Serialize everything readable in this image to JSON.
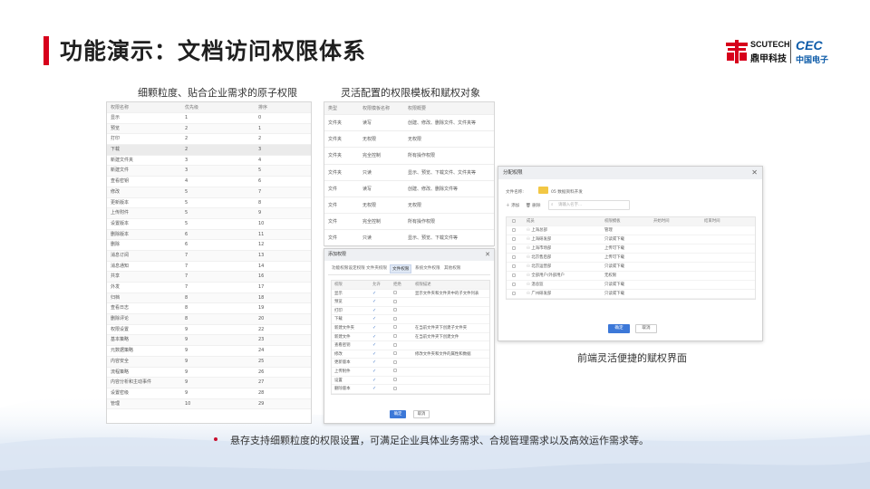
{
  "slide": {
    "title": "功能演示：文档访问权限体系",
    "logo": {
      "scutech_en": "SCUTECH",
      "scutech_cn": "鼎甲科技",
      "cec_en": "CEC",
      "cec_cn": "中国电子"
    },
    "caption_left": "细颗粒度、贴合企业需求的原子权限",
    "caption_mid": "灵活配置的权限模板和赋权对象",
    "caption_right": "前端灵活便捷的赋权界面",
    "bullet": "悬存支持细颗粒度的权限设置，可满足企业具体业务需求、合规管理需求以及高效运作需求等。"
  },
  "atom_table": {
    "headers": [
      "权限名称",
      "优先级",
      "排序"
    ],
    "rows": [
      [
        "显示",
        "1",
        "0"
      ],
      [
        "预览",
        "2",
        "1"
      ],
      [
        "打印",
        "2",
        "2"
      ],
      [
        "下载",
        "2",
        "3"
      ],
      [
        "新建文件夹",
        "3",
        "4"
      ],
      [
        "新建文件",
        "3",
        "5"
      ],
      [
        "查看密钥",
        "4",
        "6"
      ],
      [
        "修改",
        "5",
        "7"
      ],
      [
        "更新版本",
        "5",
        "8"
      ],
      [
        "上传附件",
        "5",
        "9"
      ],
      [
        "设置版本",
        "5",
        "10"
      ],
      [
        "删除版本",
        "6",
        "11"
      ],
      [
        "删除",
        "6",
        "12"
      ],
      [
        "消息订阅",
        "7",
        "13"
      ],
      [
        "消息通知",
        "7",
        "14"
      ],
      [
        "共享",
        "7",
        "16"
      ],
      [
        "外发",
        "7",
        "17"
      ],
      [
        "归档",
        "8",
        "18"
      ],
      [
        "查看日志",
        "8",
        "19"
      ],
      [
        "删除评论",
        "8",
        "20"
      ],
      [
        "权限设置",
        "9",
        "22"
      ],
      [
        "基本策略",
        "9",
        "23"
      ],
      [
        "元数据策略",
        "9",
        "24"
      ],
      [
        "内容安全",
        "9",
        "25"
      ],
      [
        "流程策略",
        "9",
        "26"
      ],
      [
        "内容分析和主动事件",
        "9",
        "27"
      ],
      [
        "设置密级",
        "9",
        "28"
      ],
      [
        "管理",
        "10",
        "29"
      ]
    ]
  },
  "template_table": {
    "headers": [
      "类型",
      "权限模板名称",
      "权限概要"
    ],
    "rows": [
      [
        "文件夹",
        "读写",
        "创建、修改、删除文件、文件夹等"
      ],
      [
        "文件夹",
        "无权限",
        "无权限"
      ],
      [
        "文件夹",
        "完全控制",
        "所有操作权限"
      ],
      [
        "文件夹",
        "只读",
        "显示、预览、下载文件、文件夹等"
      ],
      [
        "文件",
        "读写",
        "创建、修改、删除文件等"
      ],
      [
        "文件",
        "无权限",
        "无权限"
      ],
      [
        "文件",
        "完全控制",
        "所有操作权限"
      ],
      [
        "文件",
        "只读",
        "显示、预览、下载文件等"
      ]
    ]
  },
  "edit_dialog": {
    "title": "添加权限",
    "tabs": [
      "功能权限设定权限",
      "文件夹权限",
      "文件权限",
      "系统文件权限",
      "其他权限"
    ],
    "active_tab": 2,
    "headers": [
      "权限",
      "允许",
      "拒绝",
      "权限描述"
    ],
    "rows": [
      [
        "显示",
        "✓",
        "",
        "显示文件夹和文件夹中的子文件列表"
      ],
      [
        "预览",
        "✓",
        "",
        ""
      ],
      [
        "打印",
        "✓",
        "",
        ""
      ],
      [
        "下载",
        "✓",
        "",
        ""
      ],
      [
        "新建文件夹",
        "✓",
        "",
        "在当前文件夹下创建子文件夹"
      ],
      [
        "新建文件",
        "✓",
        "",
        "在当前文件夹下创建文件"
      ],
      [
        "查看密钥",
        "✓",
        "",
        ""
      ],
      [
        "修改",
        "✓",
        "",
        "修改文件夹和文件的属性和数据"
      ],
      [
        "更新版本",
        "✓",
        "",
        ""
      ],
      [
        "上传附件",
        "✓",
        "",
        ""
      ],
      [
        "设置",
        "✓",
        "",
        ""
      ],
      [
        "删除版本",
        "✓",
        "",
        ""
      ]
    ],
    "ok": "确定",
    "cancel": "取消"
  },
  "assign_dialog": {
    "title": "分配权限",
    "file_label": "文件名称:",
    "file_name": "05 数据资料开发",
    "add": "添加",
    "remove": "删除",
    "search_placeholder": "请输入名字...",
    "headers": [
      "成员",
      "权限模板",
      "开始时间",
      "结束时间"
    ],
    "rows": [
      [
        "上海总部",
        "管理"
      ],
      [
        "上海研发部",
        "只读或下载"
      ],
      [
        "上海市场部",
        "上传可下载"
      ],
      [
        "北京售后部",
        "上传可下载"
      ],
      [
        "北京运营部",
        "只读或下载"
      ],
      [
        "全部用户/外部用户",
        "无权限"
      ],
      [
        "温总监",
        "只读或下载"
      ],
      [
        "广州研发部",
        "只读或下载"
      ]
    ],
    "ok": "确定",
    "cancel": "取消"
  },
  "colors": {
    "accent": "#d7001b",
    "primary_button": "#3c78d8",
    "cec_blue": "#0b5aa8"
  }
}
